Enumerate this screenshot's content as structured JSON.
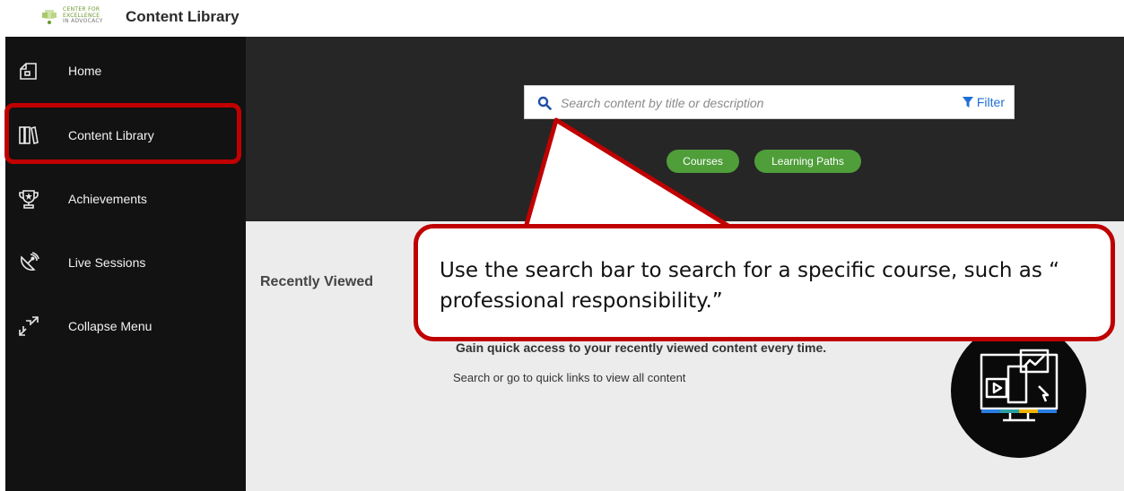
{
  "header": {
    "logo_lines": [
      "CENTER FOR",
      "EXCELLENCE",
      "IN ADVOCACY"
    ],
    "title": "Content Library"
  },
  "sidebar": {
    "items": [
      {
        "label": "Home",
        "icon": "home-icon"
      },
      {
        "label": "Content Library",
        "icon": "library-books-icon"
      },
      {
        "label": "Achievements",
        "icon": "trophy-icon"
      },
      {
        "label": "Live Sessions",
        "icon": "satellite-dish-icon"
      },
      {
        "label": "Collapse Menu",
        "icon": "collapse-arrows-icon"
      }
    ]
  },
  "search": {
    "placeholder": "Search content by title or description",
    "filter_label": "Filter"
  },
  "quick_links": {
    "courses": "Courses",
    "learning_paths": "Learning Paths"
  },
  "recently_viewed": {
    "title": "Recently Viewed",
    "empty_heading": "Gain quick access to your recently viewed content every time.",
    "empty_sub": "Search or go to quick links to view all content"
  },
  "annotation": {
    "callout_text": "Use the search bar to search for a specific course, such as “ professional responsibility.”",
    "accent_color": "#c00000"
  },
  "colors": {
    "sidebar_bg": "#121212",
    "hero_bg": "#262626",
    "pill_green": "#4f9e3a",
    "filter_blue": "#1f6fd6",
    "search_icon_blue": "#1f4fa8"
  }
}
